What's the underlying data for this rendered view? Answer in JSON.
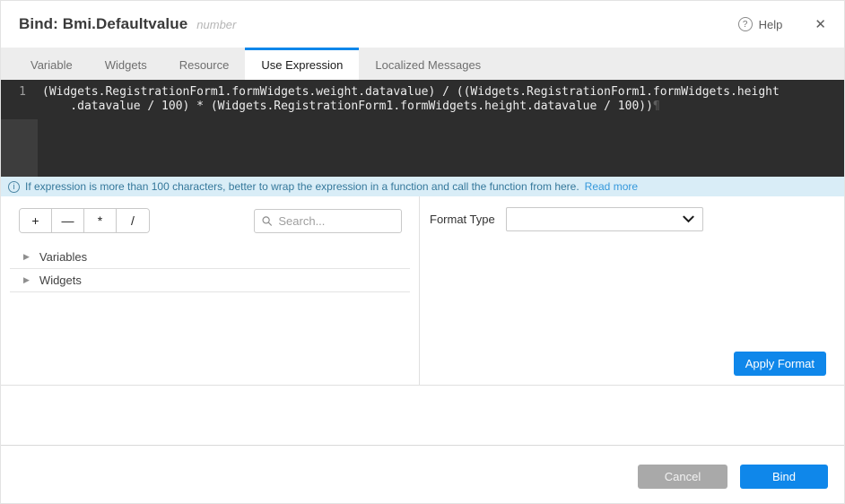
{
  "window": {
    "title": "Bind: Bmi.Defaultvalue",
    "subtitle": "number",
    "help_label": "Help"
  },
  "icons": {
    "help": "?",
    "close": "✕",
    "info": "i",
    "caret": "▶",
    "eol_mark": "¶"
  },
  "tabs": [
    {
      "label": "Variable",
      "active": false
    },
    {
      "label": "Widgets",
      "active": false
    },
    {
      "label": "Resource",
      "active": false
    },
    {
      "label": "Use Expression",
      "active": true
    },
    {
      "label": "Localized Messages",
      "active": false
    }
  ],
  "editor": {
    "line_number": "1",
    "lines": [
      "(Widgets.RegistrationForm1.formWidgets.weight.datavalue) / ((Widgets.RegistrationForm1.formWidgets.height",
      "    .datavalue / 100) * (Widgets.RegistrationForm1.formWidgets.height.datavalue / 100))"
    ],
    "expression": "(Widgets.RegistrationForm1.formWidgets.weight.datavalue) / ((Widgets.RegistrationForm1.formWidgets.height.datavalue / 100) * (Widgets.RegistrationForm1.formWidgets.height.datavalue / 100))"
  },
  "info_bar": {
    "message": "If expression is more than 100 characters, better to wrap the expression in a function and call the function from here.",
    "link_label": "Read more"
  },
  "toolbar": {
    "operators": [
      "+",
      "—",
      "*",
      "/"
    ]
  },
  "search": {
    "placeholder": "Search..."
  },
  "tree": {
    "items": [
      {
        "label": "Variables"
      },
      {
        "label": "Widgets"
      }
    ]
  },
  "format": {
    "label": "Format Type",
    "selected_value": "",
    "apply_label": "Apply Format"
  },
  "footer": {
    "cancel_label": "Cancel",
    "bind_label": "Bind"
  },
  "colors": {
    "accent_blue": "#0f87ea",
    "editor_bg": "#2d2d2d",
    "gutter_bg": "#3d3d3d",
    "info_bg": "#d9edf7",
    "info_text": "#35789b",
    "cancel_gray": "#a9a9a9"
  }
}
